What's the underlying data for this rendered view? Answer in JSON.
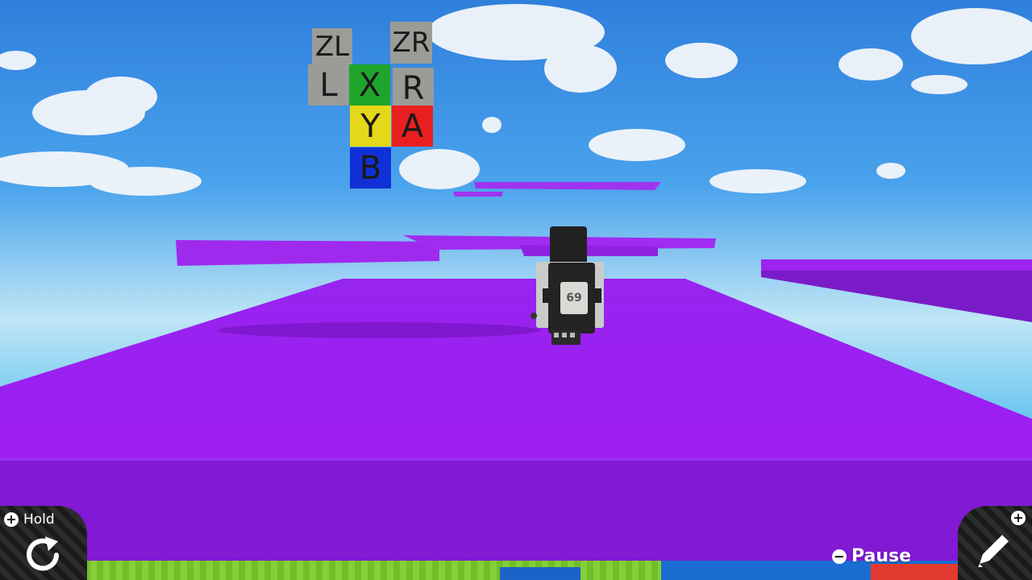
{
  "legend": {
    "keys": [
      {
        "id": "zl",
        "label": "ZL"
      },
      {
        "id": "zr",
        "label": "ZR"
      },
      {
        "id": "l",
        "label": "L"
      },
      {
        "id": "x",
        "label": "X"
      },
      {
        "id": "r",
        "label": "R"
      },
      {
        "id": "y",
        "label": "Y"
      },
      {
        "id": "a",
        "label": "A"
      },
      {
        "id": "b",
        "label": "B"
      }
    ]
  },
  "character": {
    "number": "69"
  },
  "hud": {
    "hold": {
      "button": "+",
      "label": "Hold",
      "icon": "rotate-icon"
    },
    "pause": {
      "button": "−",
      "label": "Pause"
    },
    "edit": {
      "button": "+",
      "icon": "pencil-icon"
    }
  },
  "colors": {
    "sky_top": "#2f7fdc",
    "sky_horizon": "#bfe6f6",
    "platform": "#9b1ff0",
    "platform_side": "#8219d4",
    "ground_green": "#6fbf2a",
    "hud_dark": "#1a1a1a"
  }
}
